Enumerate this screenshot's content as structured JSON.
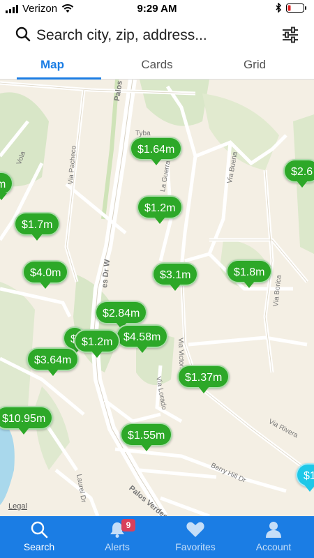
{
  "status_bar": {
    "carrier": "Verizon",
    "time": "9:29 AM"
  },
  "search": {
    "placeholder": "Search city, zip, address..."
  },
  "tabs": [
    {
      "label": "Map",
      "active": true
    },
    {
      "label": "Cards",
      "active": false
    },
    {
      "label": "Grid",
      "active": false
    }
  ],
  "map": {
    "legal": "Legal",
    "streets": [
      "Palos Verdes",
      "Via Pacheco",
      "Via Buena",
      "La Guerra",
      "Tyba",
      "Via Victoria",
      "Via Borica",
      "Via Lorado",
      "Via Rivera",
      "Berry Hill Dr",
      "Laurel Dr",
      "Palos Verdes",
      "Vola",
      "es Dr W"
    ],
    "pins": [
      {
        "price": "$1.64m"
      },
      {
        "price": "$2.6"
      },
      {
        "price": "m"
      },
      {
        "price": "$1.2m"
      },
      {
        "price": "$1.7m"
      },
      {
        "price": "$4.0m"
      },
      {
        "price": "$3.1m"
      },
      {
        "price": "$1.8m"
      },
      {
        "price": "$2.84m"
      },
      {
        "price": "$4.58m"
      },
      {
        "price": "$"
      },
      {
        "price": "$1.2m"
      },
      {
        "price": "$3.64m"
      },
      {
        "price": "$1.37m"
      },
      {
        "price": "$10.95m"
      },
      {
        "price": "$1.55m"
      },
      {
        "price": "$1"
      }
    ]
  },
  "bottom_nav": {
    "items": [
      {
        "label": "Search",
        "icon": "search-icon",
        "active": true
      },
      {
        "label": "Alerts",
        "icon": "bell-icon",
        "badge": "9"
      },
      {
        "label": "Favorites",
        "icon": "heart-icon"
      },
      {
        "label": "Account",
        "icon": "person-icon"
      }
    ]
  },
  "colors": {
    "accent": "#1b7de4",
    "pin": "#2da828",
    "pin_selected": "#1ec8e8",
    "badge": "#d9405b"
  }
}
